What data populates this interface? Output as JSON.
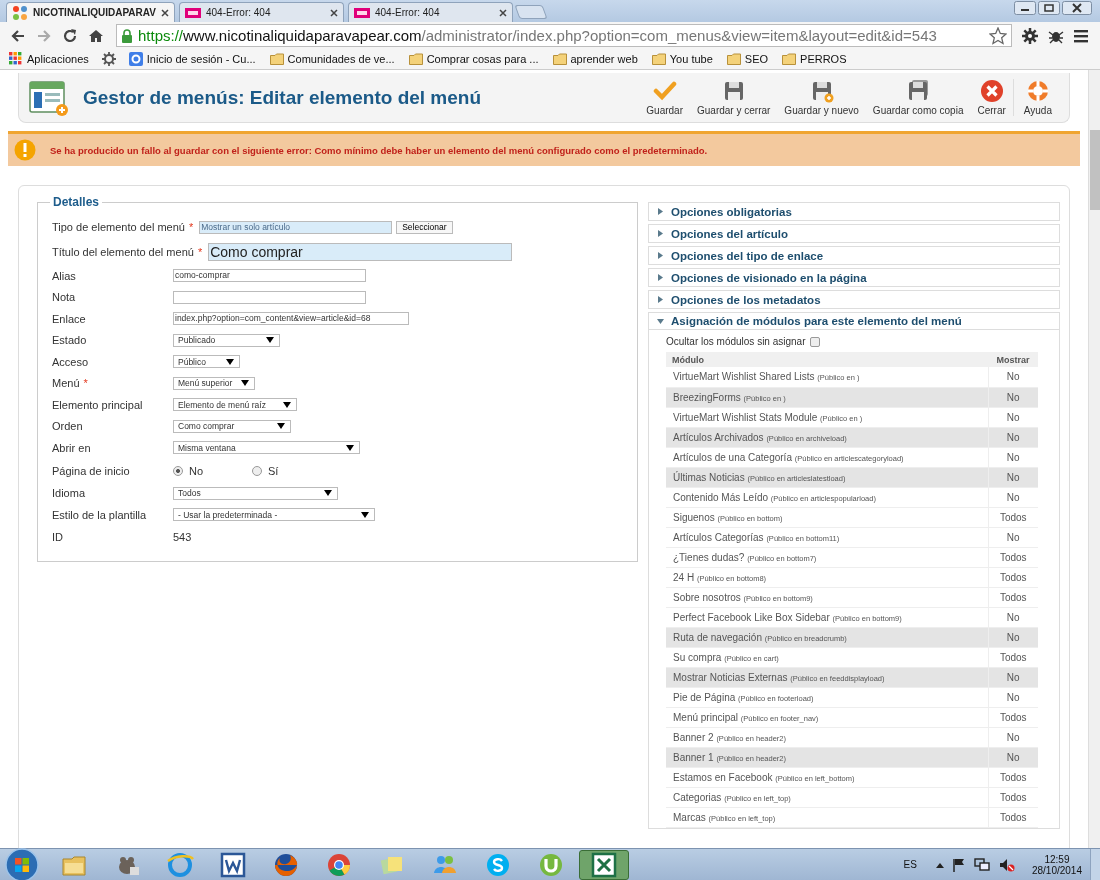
{
  "browser": {
    "tabs": [
      {
        "label": "NICOTINALIQUIDAPARAV",
        "kind": "joomla",
        "selected": true
      },
      {
        "label": "404-Error: 404",
        "kind": "site",
        "selected": false
      },
      {
        "label": "404-Error: 404",
        "kind": "site",
        "selected": false
      }
    ],
    "address": {
      "scheme": "https://",
      "host": "www.nicotinaliquidaparavapear.com",
      "path": "/administrator/index.php?option=com_menus&view=item&layout=edit&id=543"
    },
    "bookmarks": [
      {
        "label": "Aplicaciones",
        "kind": "apps"
      },
      {
        "kind": "gear"
      },
      {
        "label": "Inicio de sesión - Cu...",
        "kind": "google"
      },
      {
        "label": "Comunidades de ve...",
        "kind": "folder"
      },
      {
        "label": "Comprar cosas para ...",
        "kind": "folder"
      },
      {
        "label": "aprender web",
        "kind": "folder"
      },
      {
        "label": "You tube",
        "kind": "folder"
      },
      {
        "label": "SEO",
        "kind": "folder"
      },
      {
        "label": "PERROS",
        "kind": "folder"
      }
    ]
  },
  "toolbar": {
    "title": "Gestor de menús: Editar elemento del menú",
    "buttons": [
      {
        "label": "Guardar",
        "kind": "check"
      },
      {
        "label": "Guardar y cerrar",
        "kind": "save"
      },
      {
        "label": "Guardar y nuevo",
        "kind": "save-new"
      },
      {
        "label": "Guardar como copia",
        "kind": "save-copy"
      },
      {
        "label": "Cerrar",
        "kind": "close"
      },
      {
        "label": "Ayuda",
        "kind": "help"
      }
    ]
  },
  "alert": {
    "message": "Se ha producido un fallo al guardar con el siguiente error: Como mínimo debe haber un elemento del menú configurado como el predeterminado."
  },
  "details": {
    "legend": "Detalles",
    "fields": [
      {
        "label": "Tipo de elemento del menú",
        "marker": "*",
        "kind": "picker",
        "value": "Mostrar un solo artículo",
        "button": "Seleccionar"
      },
      {
        "label": "Título del elemento del menú",
        "marker": "*",
        "kind": "title",
        "value": "Como comprar"
      },
      {
        "label": "Alias",
        "kind": "text",
        "value": "como-comprar"
      },
      {
        "label": "Nota",
        "kind": "text"
      },
      {
        "label": "Enlace",
        "kind": "link",
        "value": "index.php?option=com_content&view=article&id=68"
      },
      {
        "label": "Estado",
        "kind": "select",
        "value": "Publicado"
      },
      {
        "label": "Acceso",
        "kind": "select",
        "value": "Público"
      },
      {
        "label": "Menú",
        "marker": "*",
        "kind": "select",
        "value": "Menú superior"
      },
      {
        "label": "Elemento principal",
        "kind": "select",
        "value": "Elemento de menú raíz"
      },
      {
        "label": "Orden",
        "kind": "select",
        "value": "Como comprar"
      },
      {
        "label": "Abrir en",
        "kind": "select",
        "value": "Misma ventana"
      },
      {
        "label": "Página de inicio",
        "kind": "radio",
        "options": [
          {
            "label": "No",
            "selected": true
          },
          {
            "label": "Sí",
            "selected": false
          }
        ]
      },
      {
        "label": "Idioma",
        "kind": "select",
        "value": "Todos"
      },
      {
        "label": "Estilo de la plantilla",
        "kind": "select",
        "value": "- Usar la predeterminada -"
      },
      {
        "label": "ID",
        "kind": "static",
        "value": "543"
      }
    ]
  },
  "sliders": [
    {
      "title": "Opciones obligatorias",
      "expanded": false
    },
    {
      "title": "Opciones del artículo",
      "expanded": false
    },
    {
      "title": "Opciones del tipo de enlace",
      "expanded": false
    },
    {
      "title": "Opciones de visionado en la página",
      "expanded": false
    },
    {
      "title": "Opciones de los metadatos",
      "expanded": false
    },
    {
      "title": "Asignación de módulos para este elemento del menú",
      "expanded": true
    }
  ],
  "modules": {
    "hide_label": "Ocultar los módulos sin asignar",
    "hide_checked": false,
    "columns": [
      "Módulo",
      "Mostrar"
    ],
    "rows": [
      {
        "name": "VirtueMart Wishlist Shared Lists",
        "position": "(Público en )",
        "show": "No",
        "highlighted": false
      },
      {
        "name": "BreezingForms",
        "position": "(Público en )",
        "show": "No",
        "highlighted": true
      },
      {
        "name": "VirtueMart Wishlist Stats Module",
        "position": "(Público en )",
        "show": "No",
        "highlighted": false
      },
      {
        "name": "Artículos Archivados",
        "position": "(Público en archiveload)",
        "show": "No",
        "highlighted": true
      },
      {
        "name": "Artículos de una Categoría",
        "position": "(Público en articlescategoryload)",
        "show": "No",
        "highlighted": false
      },
      {
        "name": "Últimas Noticias",
        "position": "(Público en articleslatestload)",
        "show": "No",
        "highlighted": true
      },
      {
        "name": "Contenido Más Leído",
        "position": "(Público en articlespopularload)",
        "show": "No",
        "highlighted": false
      },
      {
        "name": "Siguenos",
        "position": "(Público en bottom)",
        "show": "Todos",
        "highlighted": false
      },
      {
        "name": "Artículos Categorías",
        "position": "(Público en bottom11)",
        "show": "No",
        "highlighted": false
      },
      {
        "name": "¿Tienes dudas?",
        "position": "(Público en bottom7)",
        "show": "Todos",
        "highlighted": false
      },
      {
        "name": "24 H",
        "position": "(Público en bottom8)",
        "show": "Todos",
        "highlighted": false
      },
      {
        "name": "Sobre nosotros",
        "position": "(Público en bottom9)",
        "show": "Todos",
        "highlighted": false
      },
      {
        "name": "Perfect Facebook Like Box Sidebar",
        "position": "(Público en bottom9)",
        "show": "No",
        "highlighted": false
      },
      {
        "name": "Ruta de navegación",
        "position": "(Público en breadcrumb)",
        "show": "No",
        "highlighted": true
      },
      {
        "name": "Su compra",
        "position": "(Público en cart)",
        "show": "Todos",
        "highlighted": false
      },
      {
        "name": "Mostrar Noticias Externas",
        "position": "(Público en feeddisplayload)",
        "show": "No",
        "highlighted": true
      },
      {
        "name": "Pie de Página",
        "position": "(Público en footerload)",
        "show": "No",
        "highlighted": false
      },
      {
        "name": "Menú principal",
        "position": "(Público en footer_nav)",
        "show": "Todos",
        "highlighted": false
      },
      {
        "name": "Banner 2",
        "position": "(Público en header2)",
        "show": "No",
        "highlighted": false
      },
      {
        "name": "Banner 1",
        "position": "(Público en header2)",
        "show": "No",
        "highlighted": true
      },
      {
        "name": "Estamos en Facebook",
        "position": "(Público en left_bottom)",
        "show": "Todos",
        "highlighted": false
      },
      {
        "name": "Categorias",
        "position": "(Público en left_top)",
        "show": "Todos",
        "highlighted": false
      },
      {
        "name": "Marcas",
        "position": "(Público en left_top)",
        "show": "Todos",
        "highlighted": false
      }
    ]
  },
  "taskbar": {
    "apps": [
      {
        "kind": "folder",
        "active": false
      },
      {
        "kind": "mascot",
        "active": false
      },
      {
        "kind": "globe",
        "active": false
      },
      {
        "kind": "word",
        "active": false
      },
      {
        "kind": "fox",
        "active": false
      },
      {
        "kind": "chrome",
        "active": false
      },
      {
        "kind": "notes",
        "active": false
      },
      {
        "kind": "people",
        "active": false
      },
      {
        "kind": "skype",
        "active": false
      },
      {
        "kind": "torrent",
        "active": false
      },
      {
        "kind": "excel",
        "active": true
      }
    ],
    "language": "ES",
    "time": "12:59",
    "date": "28/10/2014"
  }
}
